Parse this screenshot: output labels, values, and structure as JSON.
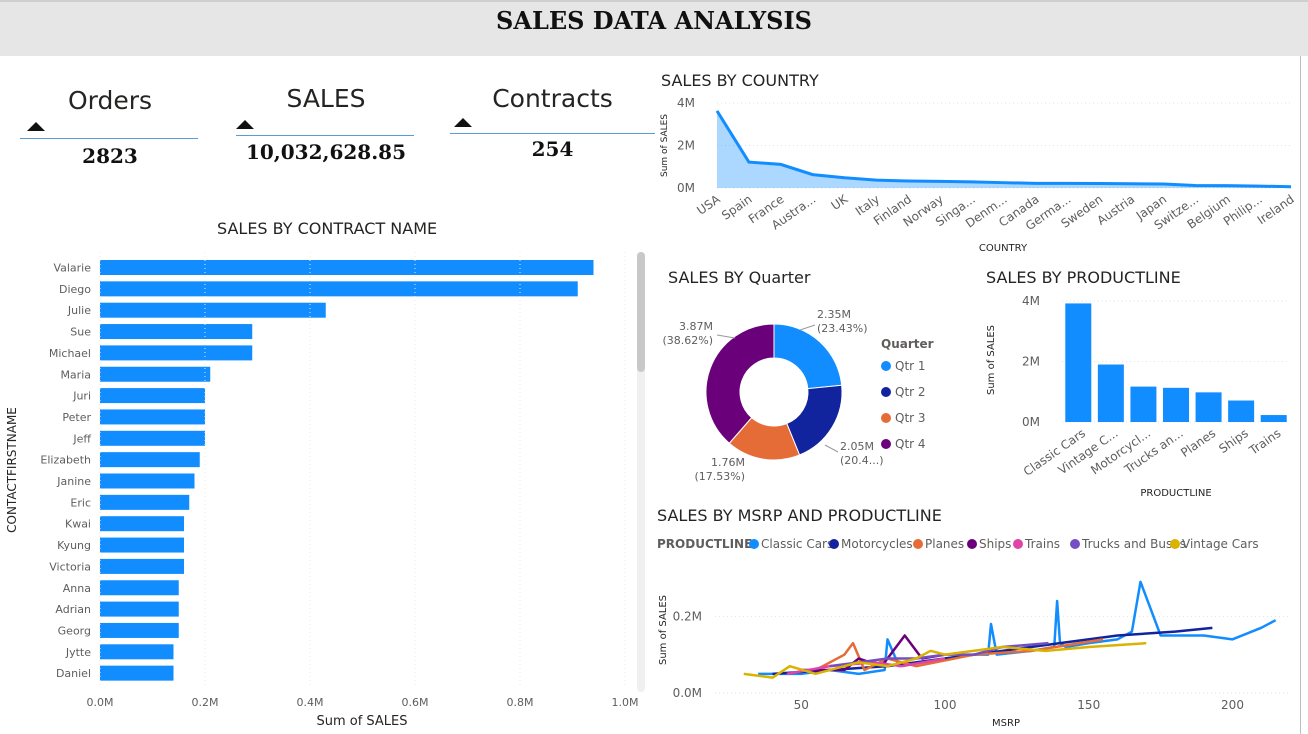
{
  "header": {
    "title": "SALES DATA ANALYSIS"
  },
  "kpis": [
    {
      "title": "Orders",
      "value": "2823"
    },
    {
      "title": "SALES",
      "value": "10,032,628.85"
    },
    {
      "title": "Contracts",
      "value": "254"
    }
  ],
  "colors": {
    "accent": "#118dff",
    "qtr1": "#118dff",
    "qtr2": "#12239e",
    "qtr3": "#e66c37",
    "qtr4": "#6b007b",
    "classic": "#118dff",
    "motorcycles": "#12239e",
    "planes": "#e66c37",
    "ships": "#6b007b",
    "trains": "#e044a7",
    "trucks": "#744ec2",
    "vintage": "#d9b300"
  },
  "chart_data": [
    {
      "id": "country",
      "type": "area",
      "title": "SALES BY COUNTRY",
      "xlabel": "COUNTRY",
      "ylabel": "Sum of SALES",
      "categories": [
        "USA",
        "Spain",
        "France",
        "Austra...",
        "UK",
        "Italy",
        "Finland",
        "Norway",
        "Singa...",
        "Denm...",
        "Canada",
        "Germa...",
        "Sweden",
        "Austria",
        "Japan",
        "Switze...",
        "Belgium",
        "Philip...",
        "Ireland"
      ],
      "values": [
        3.63,
        1.22,
        1.11,
        0.63,
        0.48,
        0.37,
        0.33,
        0.31,
        0.29,
        0.25,
        0.22,
        0.22,
        0.21,
        0.2,
        0.19,
        0.12,
        0.11,
        0.09,
        0.06
      ],
      "yticks": [
        "0M",
        "2M",
        "4M"
      ],
      "ylim": [
        0,
        4
      ],
      "units": "M"
    },
    {
      "id": "contact",
      "type": "bar",
      "orientation": "horizontal",
      "title": "SALES BY CONTRACT NAME",
      "xlabel": "Sum of SALES",
      "ylabel": "CONTACTFIRSTNAME",
      "categories": [
        "Valarie",
        "Diego",
        "Julie",
        "Sue",
        "Michael",
        "Maria",
        "Juri",
        "Peter",
        "Jeff",
        "Elizabeth",
        "Janine",
        "Eric",
        "Kwai",
        "Kyung",
        "Victoria",
        "Anna",
        "Adrian",
        "Georg",
        "Jytte",
        "Daniel"
      ],
      "values": [
        0.94,
        0.91,
        0.43,
        0.29,
        0.29,
        0.21,
        0.2,
        0.2,
        0.2,
        0.19,
        0.18,
        0.17,
        0.16,
        0.16,
        0.16,
        0.15,
        0.15,
        0.15,
        0.14,
        0.14
      ],
      "xticks": [
        "0.0M",
        "0.2M",
        "0.4M",
        "0.6M",
        "0.8M",
        "1.0M"
      ],
      "xlim": [
        0,
        1.0
      ]
    },
    {
      "id": "quarter",
      "type": "pie",
      "style": "donut",
      "title": "SALES BY Quarter",
      "legend_title": "Quarter",
      "slices": [
        {
          "name": "Qtr 1",
          "value": 2.35,
          "label": "2.35M",
          "pct": "(23.43%)"
        },
        {
          "name": "Qtr 2",
          "value": 2.05,
          "label": "2.05M",
          "pct": "(20.4...)"
        },
        {
          "name": "Qtr 3",
          "value": 1.76,
          "label": "1.76M",
          "pct": "(17.53%)"
        },
        {
          "name": "Qtr 4",
          "value": 3.87,
          "label": "3.87M",
          "pct": "(38.62%)"
        }
      ]
    },
    {
      "id": "productline",
      "type": "bar",
      "title": "SALES BY PRODUCTLINE",
      "xlabel": "PRODUCTLINE",
      "ylabel": "Sum of SALES",
      "categories": [
        "Classic Cars",
        "Vintage C...",
        "Motorcycl...",
        "Trucks an...",
        "Planes",
        "Ships",
        "Trains"
      ],
      "values": [
        3.92,
        1.9,
        1.17,
        1.13,
        0.98,
        0.71,
        0.23
      ],
      "yticks": [
        "0M",
        "2M",
        "4M"
      ],
      "ylim": [
        0,
        4
      ]
    },
    {
      "id": "msrp",
      "type": "line",
      "title": "SALES BY MSRP AND PRODUCTLINE",
      "legend_title": "PRODUCTLINE",
      "xlabel": "MSRP",
      "ylabel": "Sum of SALES",
      "xticks": [
        "50",
        "100",
        "150",
        "200"
      ],
      "yticks": [
        "0.0M",
        "0.2M"
      ],
      "xlim": [
        20,
        220
      ],
      "ylim": [
        0,
        0.3
      ],
      "series": [
        {
          "name": "Classic Cars",
          "x": [
            35,
            50,
            60,
            70,
            79,
            80,
            84,
            90,
            100,
            110,
            115,
            116,
            118,
            130,
            138,
            139,
            140,
            142,
            150,
            160,
            165,
            168,
            175,
            190,
            200,
            210,
            215
          ],
          "y": [
            0.05,
            0.05,
            0.06,
            0.05,
            0.06,
            0.14,
            0.07,
            0.08,
            0.09,
            0.1,
            0.1,
            0.18,
            0.1,
            0.11,
            0.12,
            0.24,
            0.13,
            0.12,
            0.13,
            0.14,
            0.16,
            0.29,
            0.15,
            0.15,
            0.14,
            0.17,
            0.19
          ]
        },
        {
          "name": "Motorcycles",
          "x": [
            40,
            60,
            80,
            100,
            120,
            140,
            160,
            180,
            193
          ],
          "y": [
            0.05,
            0.06,
            0.07,
            0.09,
            0.11,
            0.13,
            0.15,
            0.16,
            0.17
          ]
        },
        {
          "name": "Planes",
          "x": [
            55,
            65,
            68,
            72,
            80,
            90,
            110,
            130,
            155
          ],
          "y": [
            0.06,
            0.1,
            0.13,
            0.06,
            0.09,
            0.07,
            0.1,
            0.11,
            0.14
          ]
        },
        {
          "name": "Ships",
          "x": [
            50,
            65,
            70,
            78,
            86,
            92,
            100
          ],
          "y": [
            0.06,
            0.06,
            0.09,
            0.07,
            0.15,
            0.09,
            0.1
          ]
        },
        {
          "name": "Trains",
          "x": [
            45,
            60,
            75,
            85,
            100
          ],
          "y": [
            0.05,
            0.07,
            0.08,
            0.07,
            0.09
          ]
        },
        {
          "name": "Trucks and Buses",
          "x": [
            60,
            70,
            80,
            90,
            100,
            110,
            120,
            136
          ],
          "y": [
            0.07,
            0.08,
            0.09,
            0.09,
            0.1,
            0.1,
            0.12,
            0.13
          ]
        },
        {
          "name": "Vintage Cars",
          "x": [
            30,
            40,
            46,
            55,
            70,
            80,
            90,
            95,
            100,
            120,
            135,
            150,
            170
          ],
          "y": [
            0.05,
            0.04,
            0.07,
            0.05,
            0.08,
            0.07,
            0.09,
            0.11,
            0.1,
            0.12,
            0.11,
            0.12,
            0.13
          ]
        }
      ]
    }
  ]
}
